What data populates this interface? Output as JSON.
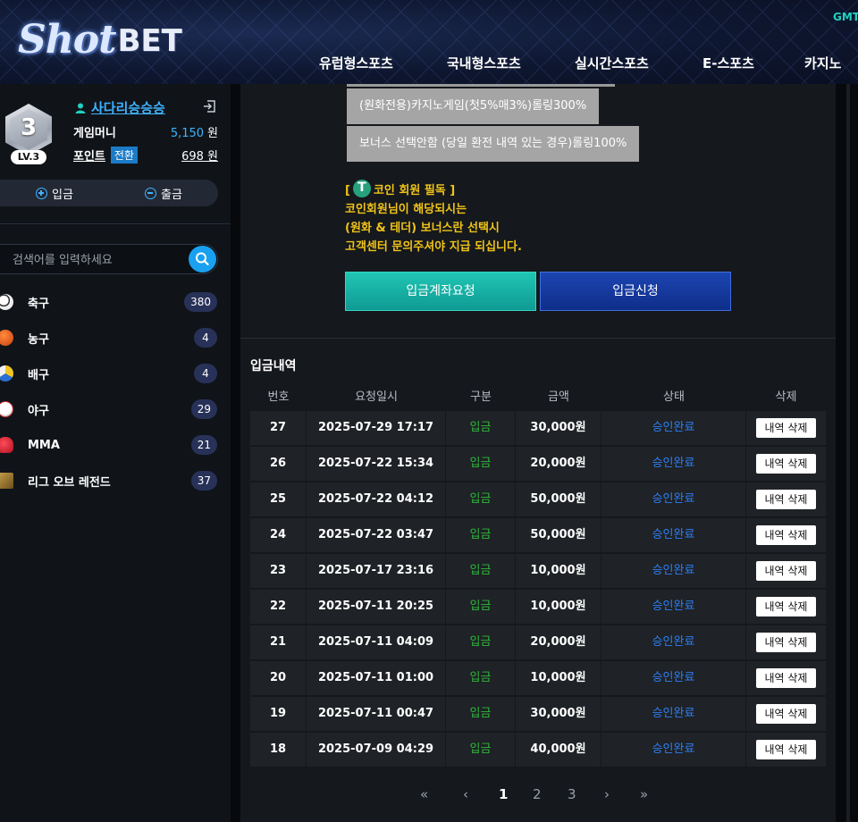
{
  "header": {
    "logo_shot": "Shot",
    "logo_bet": "BET",
    "timezone": "GMT",
    "nav": [
      "유럽형스포츠",
      "국내형스포츠",
      "실시간스포츠",
      "E-스포츠",
      "카지노"
    ]
  },
  "user": {
    "level_number": "3",
    "level_label": "LV.3",
    "username": "사다리승승승",
    "game_money_label": "게임머니",
    "game_money_value": "5,150",
    "currency": "원",
    "point_label": "포인트",
    "convert_label": "전환",
    "point_value": "698",
    "deposit_label": "입금",
    "withdraw_label": "출금"
  },
  "search": {
    "placeholder": "검색어를 입력하세요"
  },
  "sports": [
    {
      "name": "축구",
      "count": "380",
      "icon": "soccer-ball-icon"
    },
    {
      "name": "농구",
      "count": "4",
      "icon": "basketball-icon"
    },
    {
      "name": "배구",
      "count": "4",
      "icon": "volleyball-icon"
    },
    {
      "name": "야구",
      "count": "29",
      "icon": "baseball-icon"
    },
    {
      "name": "MMA",
      "count": "21",
      "icon": "boxing-glove-icon"
    },
    {
      "name": "리그 오브 레전드",
      "count": "37",
      "icon": "lol-icon"
    }
  ],
  "rules": [
    "(원화전용)카지노게임(첫5%매3%)롤링300%",
    "보너스 선택안함 (당일 환전 내역 있는 경우)롤링100%"
  ],
  "coin_notice": {
    "open": "[",
    "title": "코인 회원 필독 ]",
    "line1": "코인회원님이 해당되시는",
    "line2": "(원화 & 테더) 보너스란 선택시",
    "line3": "고객센터 문의주셔야 지급 되십니다."
  },
  "buttons": {
    "account_request": "입금계좌요청",
    "deposit_request": "입금신청"
  },
  "history": {
    "title": "입금내역",
    "headers": [
      "번호",
      "요청일시",
      "구분",
      "금액",
      "상태",
      "삭제"
    ],
    "delete_label": "내역 삭제",
    "rows": [
      {
        "no": "27",
        "date": "2025-07-29 17:17",
        "type": "입금",
        "amount": "30,000원",
        "status": "승인완료"
      },
      {
        "no": "26",
        "date": "2025-07-22 15:34",
        "type": "입금",
        "amount": "20,000원",
        "status": "승인완료"
      },
      {
        "no": "25",
        "date": "2025-07-22 04:12",
        "type": "입금",
        "amount": "50,000원",
        "status": "승인완료"
      },
      {
        "no": "24",
        "date": "2025-07-22 03:47",
        "type": "입금",
        "amount": "50,000원",
        "status": "승인완료"
      },
      {
        "no": "23",
        "date": "2025-07-17 23:16",
        "type": "입금",
        "amount": "10,000원",
        "status": "승인완료"
      },
      {
        "no": "22",
        "date": "2025-07-11 20:25",
        "type": "입금",
        "amount": "10,000원",
        "status": "승인완료"
      },
      {
        "no": "21",
        "date": "2025-07-11 04:09",
        "type": "입금",
        "amount": "20,000원",
        "status": "승인완료"
      },
      {
        "no": "20",
        "date": "2025-07-11 01:00",
        "type": "입금",
        "amount": "10,000원",
        "status": "승인완료"
      },
      {
        "no": "19",
        "date": "2025-07-11 00:47",
        "type": "입금",
        "amount": "30,000원",
        "status": "승인완료"
      },
      {
        "no": "18",
        "date": "2025-07-09 04:29",
        "type": "입금",
        "amount": "40,000원",
        "status": "승인완료"
      }
    ]
  },
  "pagination": {
    "first": "«",
    "prev": "‹",
    "pages": [
      "1",
      "2",
      "3"
    ],
    "current": "1",
    "next": "›",
    "last": "»"
  },
  "colors": {
    "accent_blue": "#3fb3ff",
    "approved": "#2d7ff5",
    "deposit_green": "#2eb83a",
    "coin_yellow": "#f0c419"
  }
}
